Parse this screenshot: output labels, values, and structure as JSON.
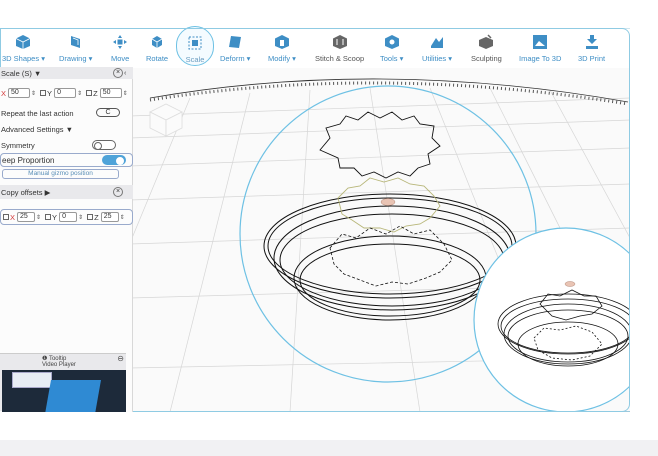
{
  "toolbar": {
    "items": [
      {
        "label": "3D Shapes ▾",
        "icon": "cube-icon"
      },
      {
        "label": "Drawing ▾",
        "icon": "pen-icon"
      },
      {
        "label": "Move",
        "icon": "move-icon"
      },
      {
        "label": "Rotate",
        "icon": "rotate-icon"
      },
      {
        "label": "Scale",
        "icon": "scale-icon"
      },
      {
        "label": "Deform ▾",
        "icon": "deform-icon"
      },
      {
        "label": "Modify ▾",
        "icon": "modify-icon"
      },
      {
        "label": "Stitch & Scoop",
        "icon": "stitch-icon"
      },
      {
        "label": "Tools ▾",
        "icon": "tools-icon"
      },
      {
        "label": "Utilities ▾",
        "icon": "utilities-icon"
      },
      {
        "label": "Sculpting",
        "icon": "sculpt-icon"
      },
      {
        "label": "Image To 3D",
        "icon": "image-icon"
      },
      {
        "label": "3D Print",
        "icon": "print-icon"
      }
    ]
  },
  "panel": {
    "title": "Scale (S) ▼",
    "x_label": "X",
    "x_value": "50",
    "y_label": "Y",
    "y_value": "0",
    "z_label": "Z",
    "z_value": "50",
    "repeat_label": "Repeat the last action",
    "repeat_button": "C",
    "advanced_label": "Advanced Settings ▼",
    "symmetry_label": "Symmetry",
    "symmetry_on": false,
    "keep_label": "eep Proportion",
    "keep_on": true,
    "manual_label": "Manual gizmo position",
    "copy_label": "Copy offsets ▶",
    "cx_label": "X",
    "cx_value": "25",
    "cy_label": "Y",
    "cy_value": "0",
    "cz_label": "Z",
    "cz_value": "25",
    "tooltip_title": "Tooltip",
    "video_label": "Video Player"
  },
  "colors": {
    "accent": "#4fa3d9",
    "toolbar_text": "#3e8ec5",
    "axis_x": "#d43b3b",
    "outline": "#6ec1e4"
  }
}
